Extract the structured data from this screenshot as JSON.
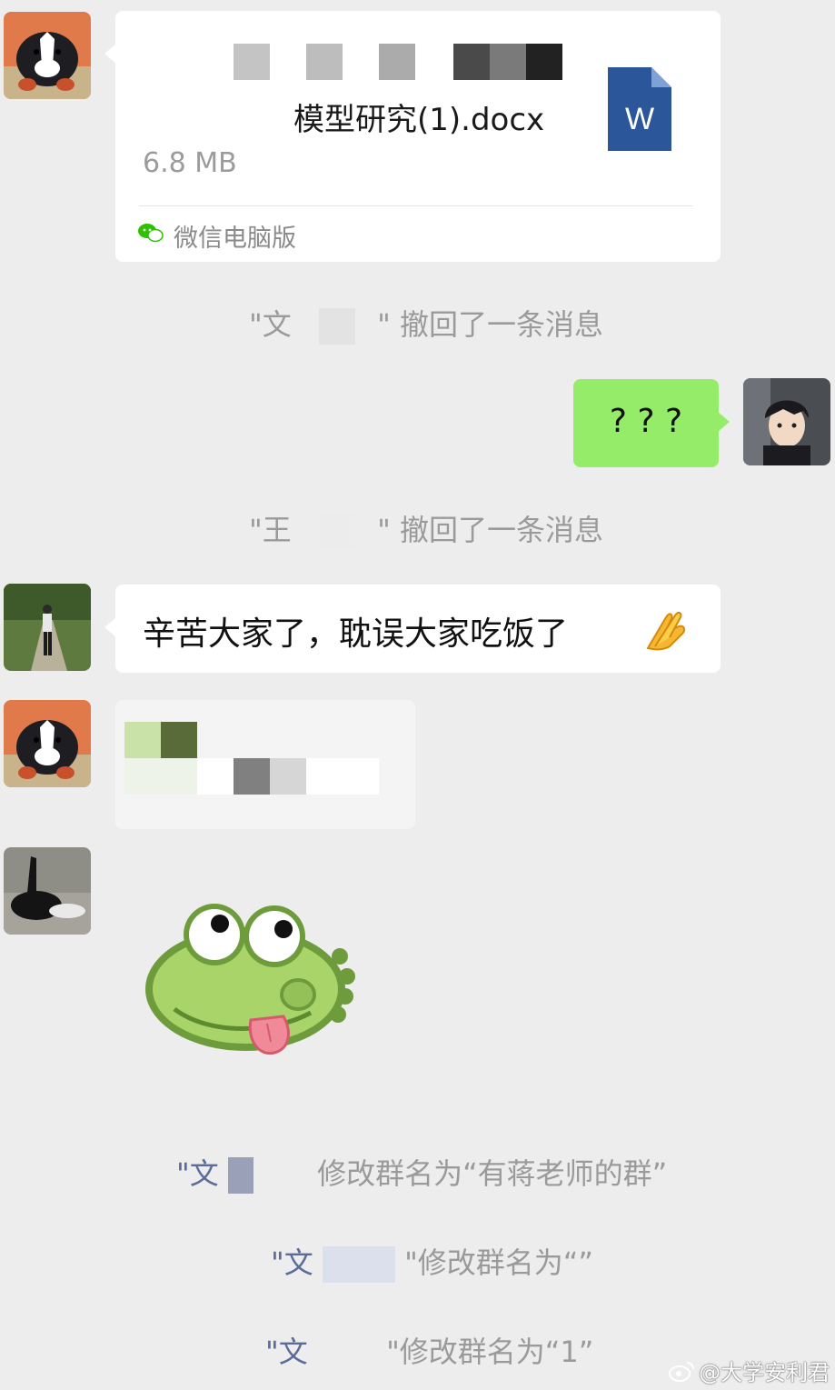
{
  "file_message": {
    "filename_visible": "模型研究(1).docx",
    "filesize": "6.8 MB",
    "source_label": "微信电脑版",
    "doc_icon_letter": "W",
    "doc_icon_color": "#2b579a"
  },
  "recall_1": {
    "prefix": "\"文",
    "suffix": "\" 撤回了一条消息"
  },
  "my_message": {
    "text": "? ? ?",
    "bubble_color": "#95ec69"
  },
  "recall_2": {
    "prefix": "\"王",
    "suffix": "\" 撤回了一条消息"
  },
  "text_message": {
    "text": "辛苦大家了，耽误大家吃饭了",
    "emoji": "🙏"
  },
  "sticker": {
    "name": "frog-tongue-sticker"
  },
  "rename_1": {
    "prefix": "\"文",
    "suffix": "修改群名为“有蒋老师的群”"
  },
  "rename_2": {
    "prefix": "\"文",
    "suffix": "\"修改群名为“”"
  },
  "rename_3": {
    "prefix": "\"文",
    "suffix": "\"修改群名为“1”"
  },
  "watermark": {
    "text": "@大学安利君"
  },
  "colors": {
    "background": "#ededed",
    "bubble_white": "#ffffff",
    "bubble_green": "#95ec69",
    "system_text": "#9a9a9a"
  }
}
